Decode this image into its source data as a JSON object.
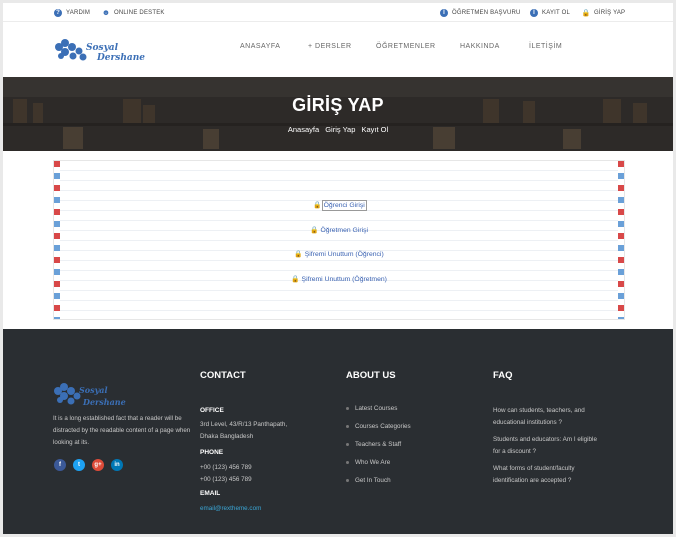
{
  "topbar": {
    "help": "YARDIM",
    "support": "ONLINE DESTEK",
    "teacher_apply": "ÖĞRETMEN BAŞVURU",
    "register": "KAYIT OL",
    "login": "GİRİŞ YAP"
  },
  "brand": {
    "line1": "Sosyal",
    "line2": "Dershane"
  },
  "nav": [
    "ANASAYFA",
    "+ DERSLER",
    "ÖĞRETMENLER",
    "HAKKINDA",
    "İLETİŞİM"
  ],
  "banner": {
    "title": "GİRİŞ YAP",
    "breadcrumb": [
      "Anasayfa",
      "Giriş Yap",
      "Kayıt Ol"
    ]
  },
  "login_links": [
    "Öğrenci Girişi",
    "Öğretmen Girişi",
    "Şifremi Unuttum (Öğrenci)",
    "Şifremi Unuttum (Öğretmen)"
  ],
  "footer": {
    "about_text": "It is a long established fact that a reader will be distracted by the readable content of a page when looking at its.",
    "social": [
      "f",
      "t",
      "g+",
      "in"
    ],
    "contact": {
      "heading": "CONTACT",
      "office_label": "OFFICE",
      "office_line1": "3rd Level, 43/R/13 Panthapath,",
      "office_line2": "Dhaka Bangladesh",
      "phone_label": "PHONE",
      "phone1": "+00 (123) 456 789",
      "phone2": "+00 (123) 456 789",
      "email_label": "EMAIL",
      "email": "email@rextheme.com"
    },
    "about": {
      "heading": "ABOUT US",
      "links": [
        "Latest Courses",
        "Courses Categories",
        "Teachers & Staff",
        "Who We Are",
        "Get In Touch"
      ]
    },
    "faq": {
      "heading": "FAQ",
      "q1_line1": "How can students, teachers, and",
      "q1_line2": "educational institutions ?",
      "q2_line1": "Students and educators: Am I eligible",
      "q2_line2": "for a discount ?",
      "q3_line1": "What forms of student/faculty",
      "q3_line2": "identification are accepted ?"
    }
  },
  "colors": {
    "brand_blue": "#3b6fb6",
    "footer_bg": "#2a2e32",
    "email": "#3aa6d6"
  }
}
